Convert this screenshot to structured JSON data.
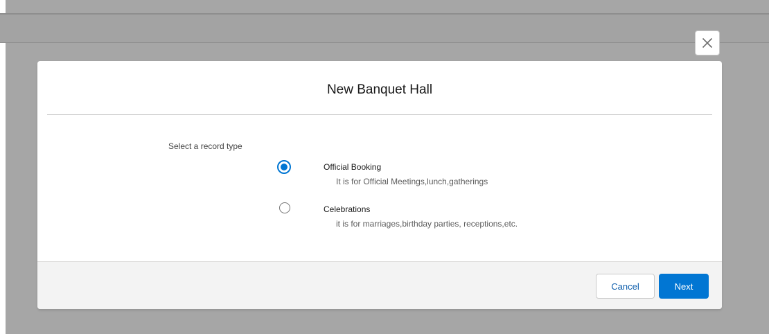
{
  "modal": {
    "title": "New Banquet Hall",
    "close_icon": "close-icon"
  },
  "record_type": {
    "label": "Select a record type",
    "options": [
      {
        "title": "Official Booking",
        "description": "It is for Official Meetings,lunch,gatherings",
        "selected": true
      },
      {
        "title": "Celebrations",
        "description": "it is for marriages,birthday parties, receptions,etc.",
        "selected": false
      }
    ]
  },
  "footer": {
    "cancel_label": "Cancel",
    "next_label": "Next"
  },
  "colors": {
    "brand": "#0176d3",
    "overlay": "#a6a6a6"
  }
}
